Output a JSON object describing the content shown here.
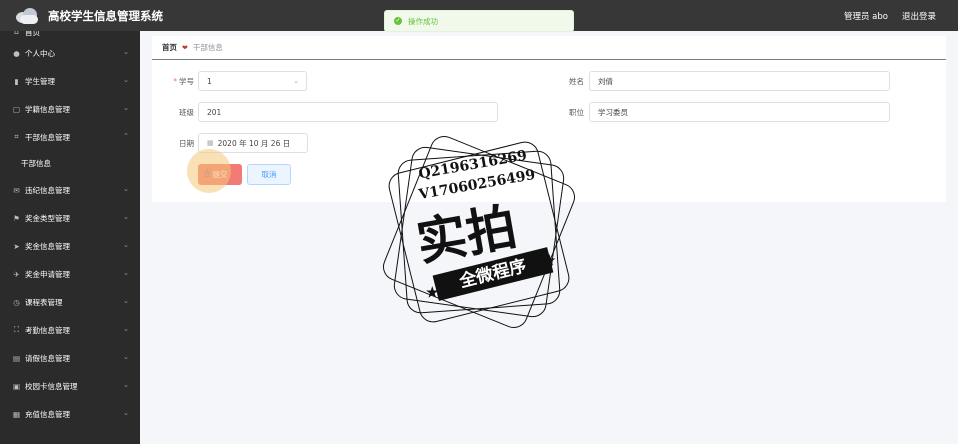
{
  "header": {
    "app_title": "高校学生信息管理系统",
    "user_label": "管理员 abo",
    "logout_label": "退出登录"
  },
  "toast": {
    "message": "操作成功"
  },
  "sidebar": {
    "items": [
      {
        "label": "首页",
        "icon": "home-icon"
      },
      {
        "label": "个人中心",
        "icon": "user-icon"
      },
      {
        "label": "学生管理",
        "icon": "bar-chart-icon"
      },
      {
        "label": "学籍信息管理",
        "icon": "document-icon"
      },
      {
        "label": "干部信息管理",
        "icon": "crop-icon"
      },
      {
        "label": "干部信息",
        "icon": ""
      },
      {
        "label": "违纪信息管理",
        "icon": "mail-icon"
      },
      {
        "label": "奖金类型管理",
        "icon": "flag-icon"
      },
      {
        "label": "奖金信息管理",
        "icon": "send-icon"
      },
      {
        "label": "奖金申请管理",
        "icon": "plane-icon"
      },
      {
        "label": "课程表管理",
        "icon": "clock-icon"
      },
      {
        "label": "考勤信息管理",
        "icon": "fullscreen-icon"
      },
      {
        "label": "请假信息管理",
        "icon": "bank-icon"
      },
      {
        "label": "校园卡信息管理",
        "icon": "card-icon"
      },
      {
        "label": "充值信息管理",
        "icon": "grid-icon"
      }
    ]
  },
  "breadcrumb": {
    "home": "首页",
    "current": "干部信息"
  },
  "form": {
    "student_id_label": "学号",
    "student_id_value": "1",
    "name_label": "姓名",
    "name_value": "刘倩",
    "class_label": "班级",
    "class_value": "201",
    "position_label": "职位",
    "position_value": "学习委员",
    "date_label": "日期",
    "date_value": "2020 年 10 月 26 日",
    "submit_label": "提交",
    "cancel_label": "取消"
  },
  "watermark": {
    "line1": "Q2196316269",
    "line2": "V17060256499",
    "big": "实拍",
    "banner": "全微程序"
  }
}
